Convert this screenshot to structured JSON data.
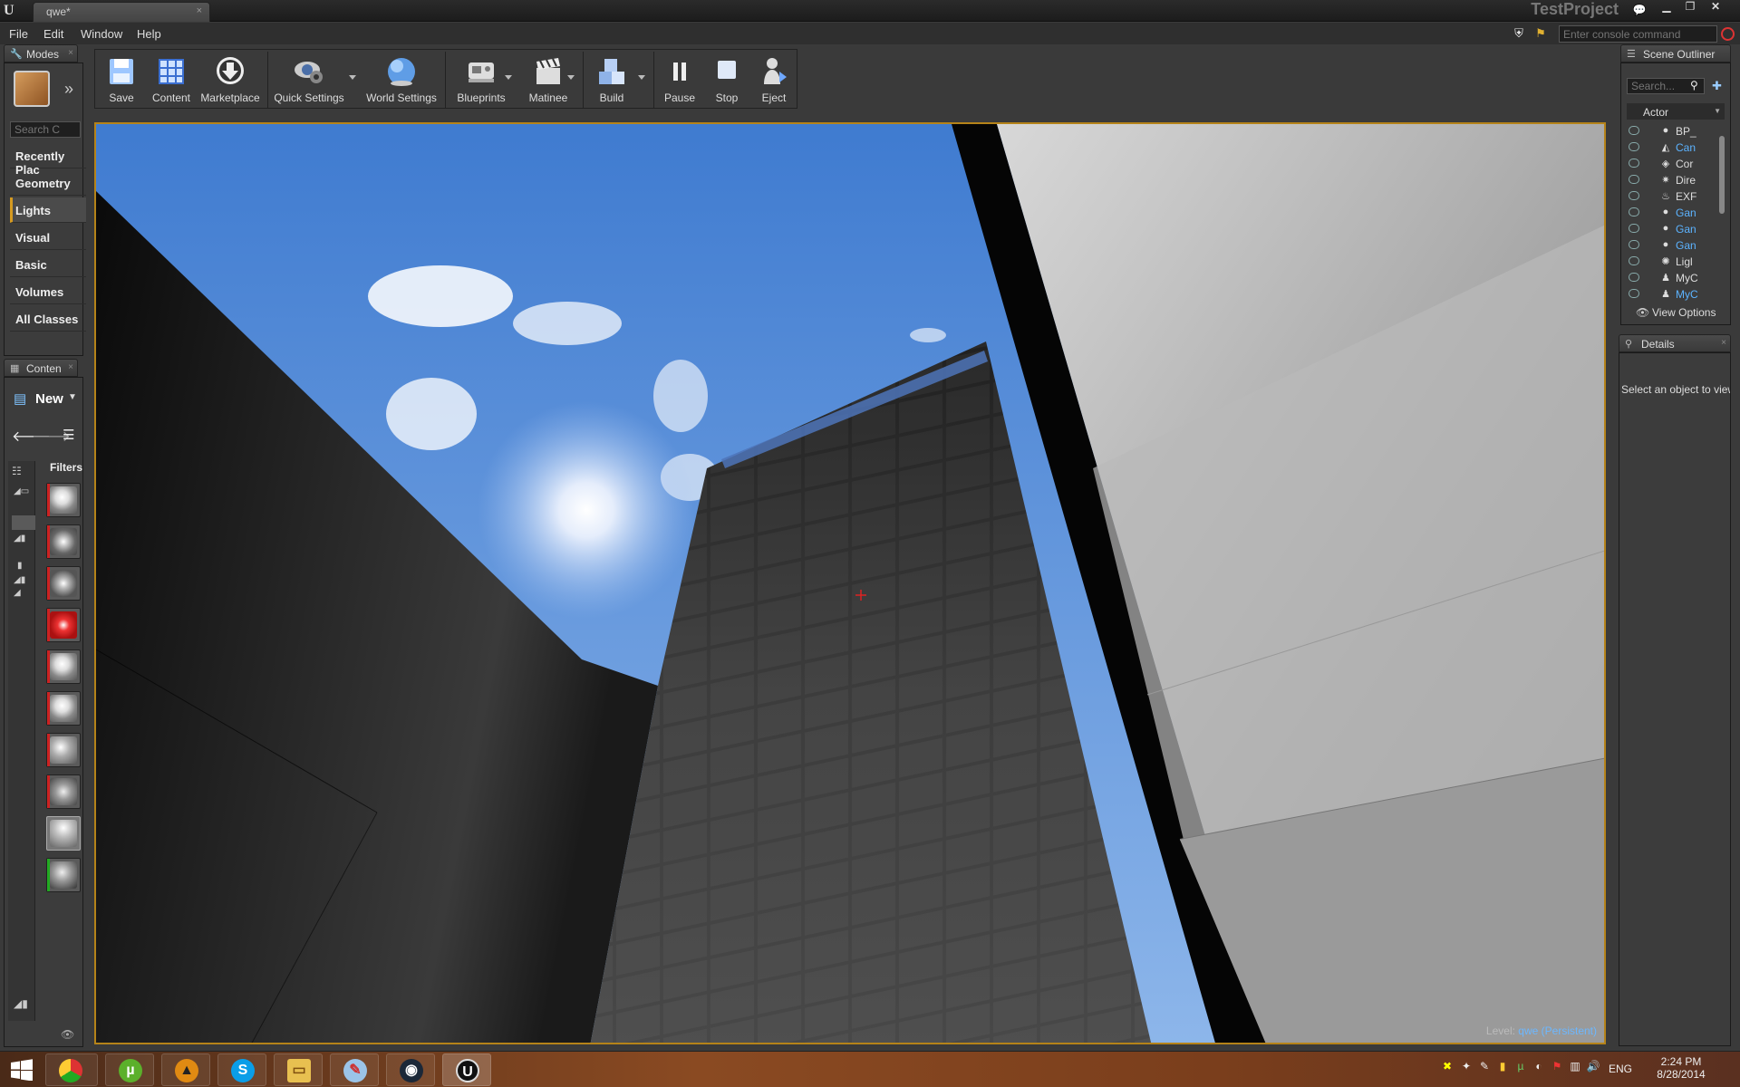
{
  "window": {
    "tab_title": "qwe*",
    "project": "TestProject",
    "tab_close": "×"
  },
  "menu": [
    "File",
    "Edit",
    "Window",
    "Help"
  ],
  "console_placeholder": "Enter console command",
  "modes": {
    "tab": "Modes",
    "search_placeholder": "Search C",
    "categories": [
      "Recently Plac",
      "Geometry",
      "Lights",
      "Visual",
      "Basic",
      "Volumes",
      "All Classes"
    ],
    "active": 2
  },
  "content": {
    "tab": "Conten",
    "new_label": "New",
    "filters_label": "Filters"
  },
  "toolbar": [
    "Save",
    "Content",
    "Marketplace",
    "Quick Settings",
    "World Settings",
    "Blueprints",
    "Matinee",
    "Build",
    "Pause",
    "Stop",
    "Eject"
  ],
  "viewport": {
    "level_label": "Level:",
    "level_name": "qwe (Persistent)"
  },
  "outliner": {
    "tab": "Scene Outliner",
    "search_placeholder": "Search...",
    "column": "Actor",
    "view_options": "View Options",
    "rows": [
      {
        "name": "BP_",
        "blue": false,
        "icon": "sphere-icon"
      },
      {
        "name": "Can",
        "blue": true,
        "icon": "camera-icon"
      },
      {
        "name": "Cor",
        "blue": false,
        "icon": "actor-icon"
      },
      {
        "name": "Dire",
        "blue": false,
        "icon": "sun-icon"
      },
      {
        "name": "EXF",
        "blue": false,
        "icon": "fog-icon"
      },
      {
        "name": "Gan",
        "blue": true,
        "icon": "sphere-icon"
      },
      {
        "name": "Gan",
        "blue": true,
        "icon": "sphere-icon"
      },
      {
        "name": "Gan",
        "blue": true,
        "icon": "sphere-icon"
      },
      {
        "name": "Ligl",
        "blue": false,
        "icon": "light-icon"
      },
      {
        "name": "MyC",
        "blue": false,
        "icon": "pawn-icon"
      },
      {
        "name": "MyC",
        "blue": true,
        "icon": "pawn-icon"
      }
    ]
  },
  "details": {
    "tab": "Details",
    "message": "Select an object to view"
  },
  "tray": {
    "lang": "ENG",
    "time": "2:24 PM",
    "date": "8/28/2014"
  }
}
